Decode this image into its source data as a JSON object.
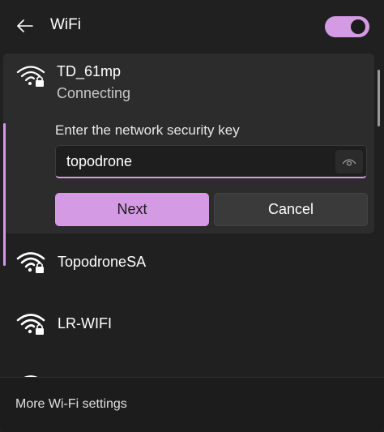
{
  "header": {
    "title": "WiFi",
    "back_icon": "back-arrow-icon",
    "toggle_state": "on",
    "accent": "#d59ae4"
  },
  "expanded_network": {
    "ssid": "TD_61mp",
    "status": "Connecting",
    "icon": "wifi-locked-icon",
    "key_label": "Enter the network security key",
    "key_value": "topodrone",
    "reveal_icon": "eye-icon",
    "next_label": "Next",
    "cancel_label": "Cancel"
  },
  "networks": [
    {
      "ssid": "TopodroneSA",
      "icon": "wifi-locked-icon"
    },
    {
      "ssid": "LR-WIFI",
      "icon": "wifi-locked-icon"
    }
  ],
  "footer": {
    "link_label": "More Wi-Fi settings"
  },
  "colors": {
    "background": "#202020",
    "card": "#2c2c2c",
    "accent": "#d59ae4"
  }
}
